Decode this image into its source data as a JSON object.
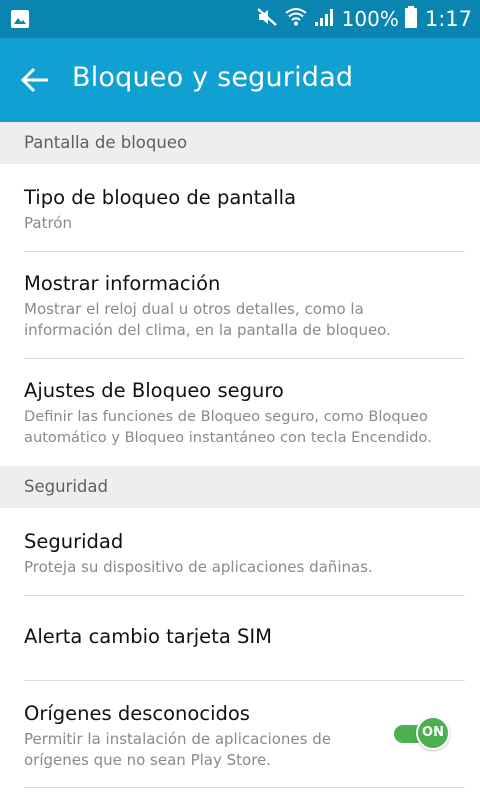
{
  "status_bar": {
    "battery_percent": "100%",
    "time": "1:17",
    "icons": [
      "gallery-icon",
      "mute-icon",
      "wifi-icon",
      "signal-icon",
      "battery-icon"
    ]
  },
  "app_bar": {
    "title": "Bloqueo y seguridad",
    "back_icon": "arrow-back-icon"
  },
  "sections": {
    "lock_screen": {
      "header": "Pantalla de bloqueo"
    },
    "security": {
      "header": "Seguridad"
    }
  },
  "items": {
    "lock_type": {
      "title": "Tipo de bloqueo de pantalla",
      "subtitle": "Patrón"
    },
    "show_info": {
      "title": "Mostrar información",
      "subtitle_line1": "Mostrar el reloj dual u otros detalles, como la",
      "subtitle_line2": "información del clima, en la pantalla de bloqueo."
    },
    "secure_lock": {
      "title": "Ajustes de Bloqueo seguro",
      "subtitle_line1": "Definir las funciones de Bloqueo seguro, como Bloqueo",
      "subtitle_line2": "automático y Bloqueo instantáneo con tecla Encendido."
    },
    "security": {
      "title": "Seguridad",
      "subtitle": "Proteja su dispositivo de aplicaciones dañinas."
    },
    "sim_alert": {
      "title": "Alerta cambio tarjeta SIM"
    },
    "unknown_sources": {
      "title": "Orígenes desconocidos",
      "subtitle_line1": "Permitir la instalación de aplicaciones de",
      "subtitle_line2": "orígenes que no sean Play Store.",
      "toggle_label": "ON",
      "toggle_state": true
    }
  },
  "colors": {
    "status_bar": "#0a85b0",
    "app_bar": "#10a0d2",
    "section_bg": "#eeeeee",
    "toggle_on": "#4caf50"
  }
}
